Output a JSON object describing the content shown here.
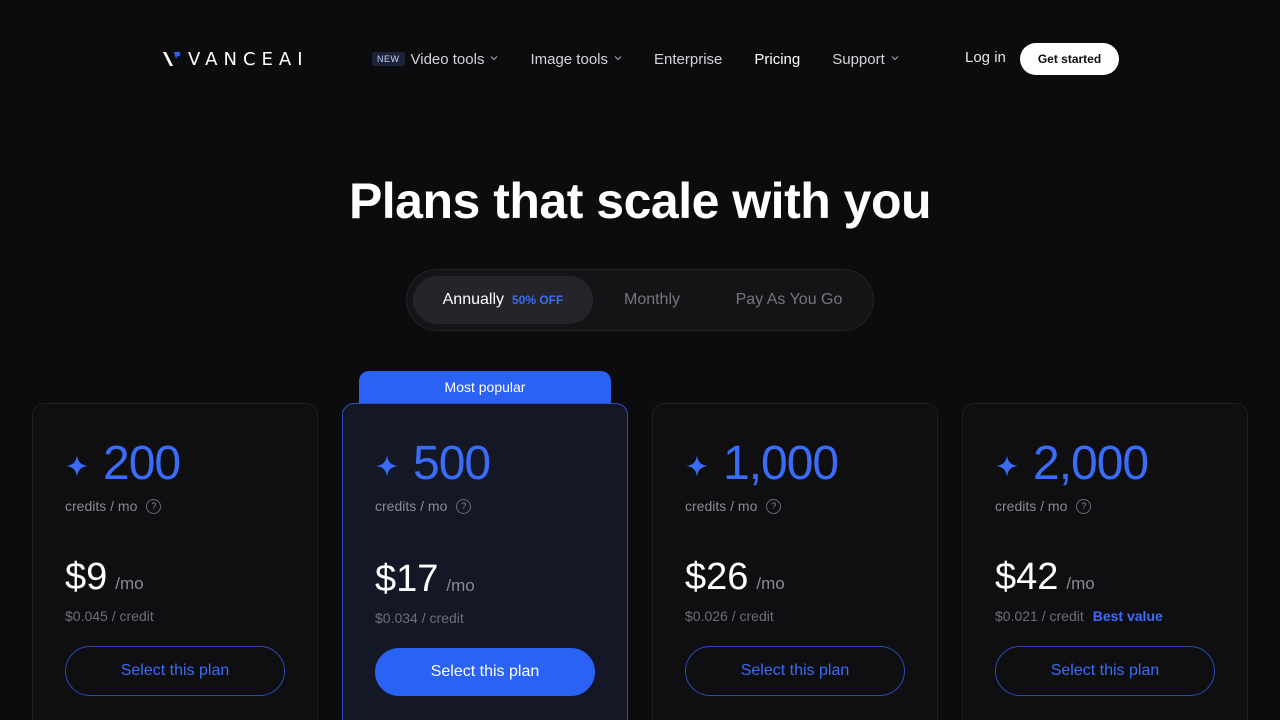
{
  "header": {
    "logo_text": "VANCEAI",
    "nav": [
      {
        "label": "Video tools",
        "badge": "NEW",
        "has_dropdown": true
      },
      {
        "label": "Image tools",
        "has_dropdown": true
      },
      {
        "label": "Enterprise",
        "has_dropdown": false
      },
      {
        "label": "Pricing",
        "has_dropdown": false,
        "active": true
      },
      {
        "label": "Support",
        "has_dropdown": true
      }
    ],
    "login_label": "Log in",
    "cta_label": "Get started"
  },
  "page_title": "Plans that scale with you",
  "billing_toggle": {
    "options": [
      {
        "label": "Annually",
        "badge": "50% OFF",
        "active": true
      },
      {
        "label": "Monthly",
        "active": false
      },
      {
        "label": "Pay As You Go",
        "active": false
      }
    ]
  },
  "popular_label": "Most popular",
  "plans": [
    {
      "credits": "200",
      "credits_label": "credits / mo",
      "price": "$9",
      "per": "/mo",
      "per_credit": "$0.045 / credit",
      "tag": "",
      "button": "Select this plan",
      "featured": false
    },
    {
      "credits": "500",
      "credits_label": "credits / mo",
      "price": "$17",
      "per": "/mo",
      "per_credit": "$0.034 / credit",
      "tag": "",
      "button": "Select this plan",
      "featured": true
    },
    {
      "credits": "1,000",
      "credits_label": "credits / mo",
      "price": "$26",
      "per": "/mo",
      "per_credit": "$0.026 / credit",
      "tag": "",
      "button": "Select this plan",
      "featured": false
    },
    {
      "credits": "2,000",
      "credits_label": "credits / mo",
      "price": "$42",
      "per": "/mo",
      "per_credit": "$0.021 / credit",
      "tag": "Best value",
      "button": "Select this plan",
      "featured": false
    }
  ],
  "help_glyph": "?",
  "colors": {
    "background": "#0c0c0e",
    "accent": "#2a62f4",
    "accent_text": "#3a6cf8"
  }
}
